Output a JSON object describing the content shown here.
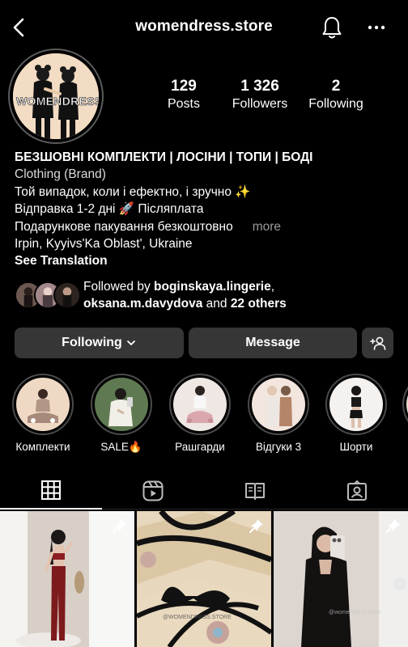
{
  "header": {
    "username": "womendress.store",
    "icons": {
      "back": "chevron-left-icon",
      "notifications": "bell-icon",
      "more": "more-horizontal-icon"
    }
  },
  "profile": {
    "avatar_logo_text": "WOMENDRESS",
    "stats": [
      {
        "value": "129",
        "label": "Posts"
      },
      {
        "value": "1 326",
        "label": "Followers"
      },
      {
        "value": "2",
        "label": "Following"
      }
    ]
  },
  "bio": {
    "name": "БЕЗШОВНІ КОМПЛЕКТИ | ЛОСІНИ | ТОПИ | БОДІ",
    "category": "Clothing (Brand)",
    "line1": "Той випадок, коли і ефектно, і зручно ✨",
    "line2": "Відправка 1-2 дні 🚀 Післяплата",
    "line3": "Подарункове пакування безкоштовно",
    "more": "more",
    "location": "Irpin, Kyyivs'Ka Oblast', Ukraine",
    "see_translation": "See Translation"
  },
  "followed_by": {
    "prefix": "Followed by ",
    "user1": "boginskaya.lingerie",
    "comma": ",",
    "user2": "oksana.m.davydova",
    "and": " and ",
    "others": "22 others"
  },
  "actions": {
    "following_label": "Following",
    "message_label": "Message"
  },
  "highlights": [
    {
      "label": "Комплекти"
    },
    {
      "label": "SALE🔥"
    },
    {
      "label": "Рашгарди"
    },
    {
      "label": "Відгуки 3"
    },
    {
      "label": "Шорти"
    }
  ],
  "tabs": [
    {
      "icon": "grid-icon",
      "active": true
    },
    {
      "icon": "reels-icon",
      "active": false
    },
    {
      "icon": "guide-icon",
      "active": false
    },
    {
      "icon": "tagged-icon",
      "active": false
    }
  ],
  "posts": [
    {
      "pinned": true
    },
    {
      "pinned": true,
      "watermark": "@WOMENDRESS.STORE"
    },
    {
      "pinned": true,
      "watermark": "@womendress.store"
    }
  ],
  "colors": {
    "background": "#000000",
    "button": "#363636",
    "muted_text": "#9a9a9a"
  }
}
